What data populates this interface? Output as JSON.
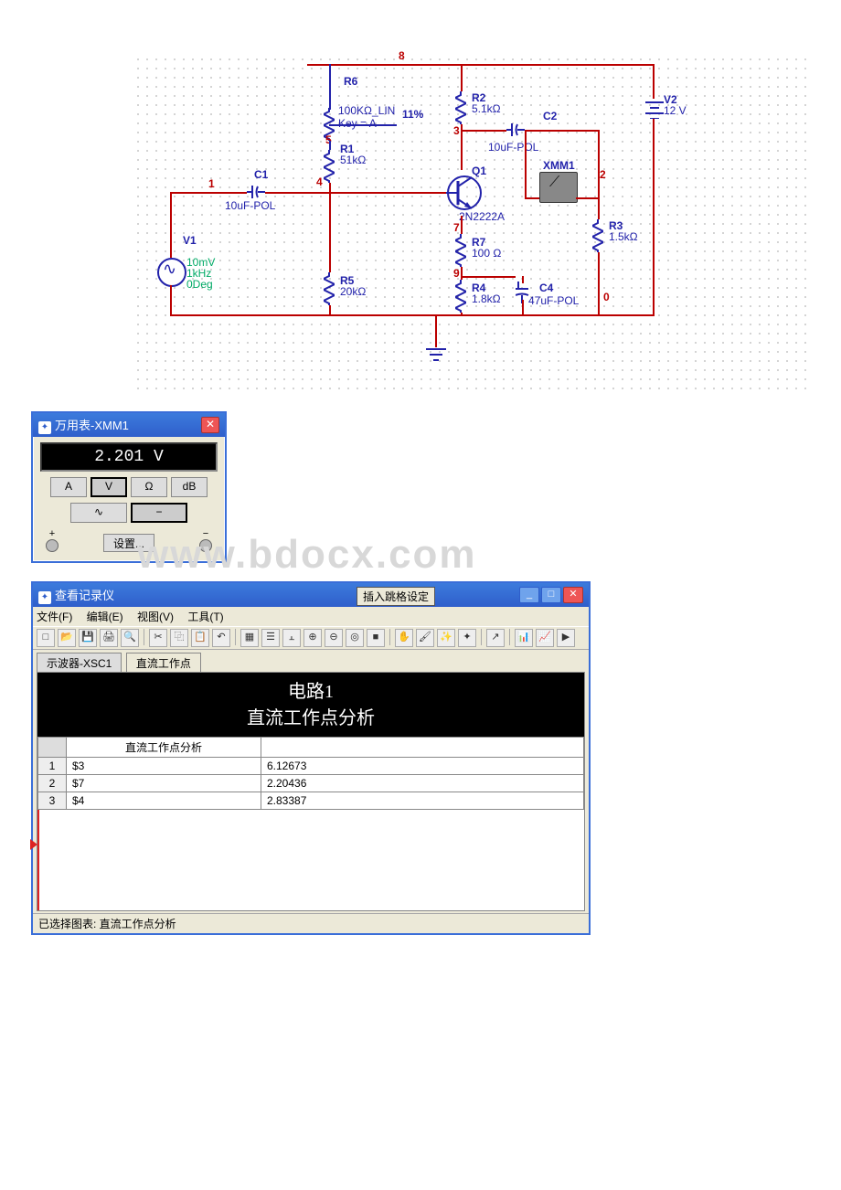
{
  "watermark": "www.bdocx.com",
  "schematic": {
    "nets": {
      "top": "8",
      "left": "1",
      "right": "2",
      "gnd": "0",
      "n3": "3",
      "n4": "4",
      "n5": "5",
      "n7": "7",
      "n9": "9"
    },
    "R6": {
      "label": "R6"
    },
    "pot": {
      "label1": "100KΩ_LIN",
      "label2": "Key = A",
      "pct": "11%"
    },
    "R1": {
      "label": "R1",
      "val": "51kΩ"
    },
    "R2": {
      "label": "R2",
      "val": "5.1kΩ"
    },
    "R3": {
      "label": "R3",
      "val": "1.5kΩ"
    },
    "R4": {
      "label": "R4",
      "val": "1.8kΩ"
    },
    "R5": {
      "label": "R5",
      "val": "20kΩ"
    },
    "R7": {
      "label": "R7",
      "val": "100 Ω"
    },
    "C1": {
      "label": "C1",
      "val": "10uF-POL"
    },
    "C2": {
      "label": "C2",
      "val": "10uF-POL"
    },
    "C4": {
      "label": "C4",
      "val": "47uF-POL"
    },
    "Q1": {
      "label": "Q1",
      "type": "2N2222A"
    },
    "V1": {
      "label": "V1",
      "amp": "10mV",
      "freq": "1kHz",
      "phase": "0Deg"
    },
    "V2": {
      "label": "V2",
      "val": "12 V"
    },
    "XMM1": {
      "label": "XMM1"
    }
  },
  "multimeter": {
    "title": "万用表-XMM1",
    "reading": "2.201 V",
    "buttons": {
      "a": "A",
      "v": "V",
      "ohm": "Ω",
      "db": "dB",
      "ac": "∿",
      "dc": "−"
    },
    "settings": "设置...",
    "plus": "+",
    "minus": "−"
  },
  "grapher": {
    "title": "查看记录仪",
    "inline_tab": "插入跳格设定",
    "menu": {
      "file": "文件(F)",
      "edit": "编辑(E)",
      "view": "视图(V)",
      "tools": "工具(T)"
    },
    "tabs": {
      "tab1": "示波器-XSC1",
      "tab2": "直流工作点"
    },
    "main_title_1": "电路1",
    "main_title_2": "直流工作点分析",
    "col_title": "直流工作点分析",
    "rows": [
      {
        "i": "1",
        "name": "$3",
        "val": "6.12673"
      },
      {
        "i": "2",
        "name": "$7",
        "val": "2.20436"
      },
      {
        "i": "3",
        "name": "$4",
        "val": "2.83387"
      }
    ],
    "status": "已选择图表:   直流工作点分析"
  }
}
